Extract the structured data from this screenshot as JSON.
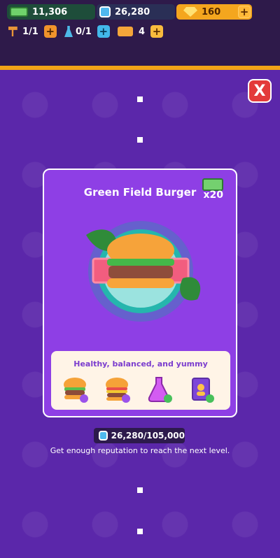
{
  "topbar": {
    "cash": "11,306",
    "reputation": "26,280",
    "gems": "160",
    "hammer": "1/1",
    "flask": "0/1",
    "tickets": "4",
    "plus": "+"
  },
  "card": {
    "title": "Green Field Burger",
    "reward": "x20",
    "description": "Healthy, balanced, and yummy"
  },
  "progress": {
    "current": "26,280",
    "target": "105,000"
  },
  "footer": {
    "text": "Get enough reputation to reach the next level."
  },
  "close_label": "X"
}
